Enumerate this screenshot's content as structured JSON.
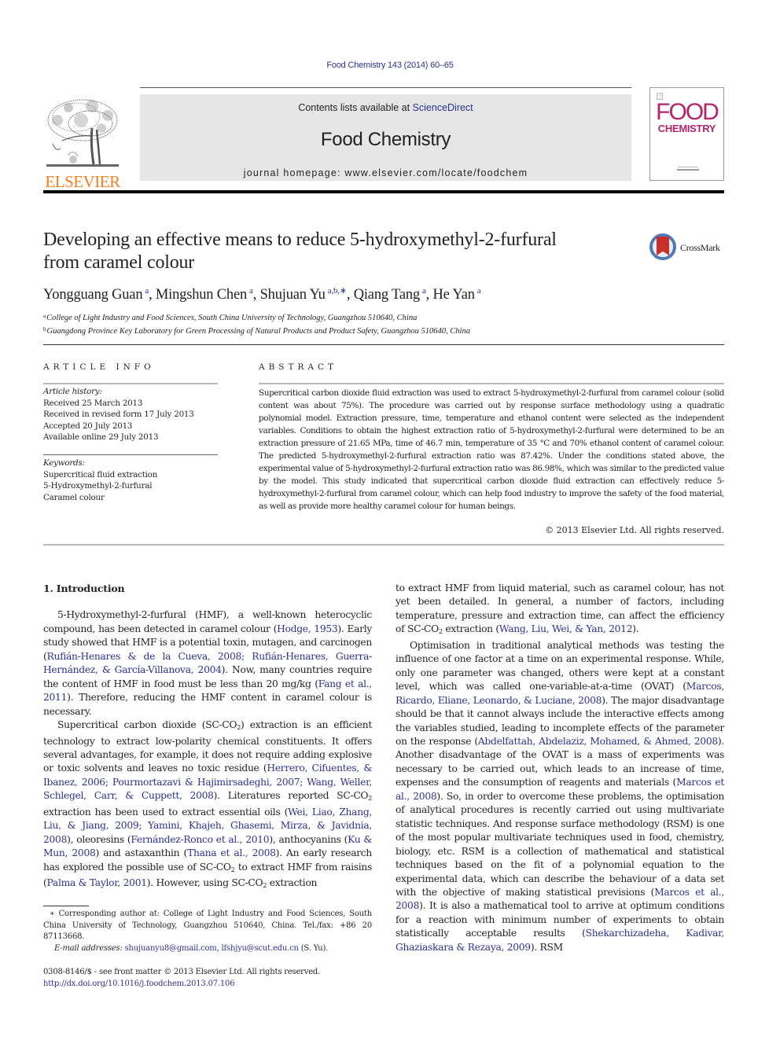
{
  "citation": "Food Chemistry 143 (2014) 60–65",
  "masthead": {
    "publisher": "ELSEVIER",
    "contents_prefix": "Contents lists available at ",
    "contents_link": "ScienceDirect",
    "journal_name": "Food Chemistry",
    "homepage": "journal homepage: www.elsevier.com/locate/foodchem",
    "cover_word1": "FOOD",
    "cover_word2": "CHEMISTRY"
  },
  "article": {
    "title_line1": "Developing an effective means to reduce 5-hydroxymethyl-2-furfural",
    "title_line2": "from caramel colour",
    "crossmark_label": "CrossMark",
    "authors": [
      {
        "name": "Yongguang Guan",
        "sup": "a"
      },
      {
        "name": "Mingshun Chen",
        "sup": "a"
      },
      {
        "name": "Shujuan Yu",
        "sup": "a,b,∗"
      },
      {
        "name": "Qiang Tang",
        "sup": "a"
      },
      {
        "name": "He Yan",
        "sup": "a"
      }
    ],
    "affiliations": [
      {
        "sup": "a",
        "text": "College of Light Industry and Food Sciences, South China University of Technology, Guangzhou 510640, China"
      },
      {
        "sup": "b",
        "text": "Guangdong Province Key Laboratory for Green Processing of Natural Products and Product Safety, Guangzhou 510640, China"
      }
    ]
  },
  "article_info": {
    "heading": "ARTICLE INFO",
    "history_label": "Article history:",
    "history": [
      "Received 25 March 2013",
      "Received in revised form 17 July 2013",
      "Accepted 20 July 2013",
      "Available online 29 July 2013"
    ],
    "keywords_label": "Keywords:",
    "keywords": [
      "Supercritical fluid extraction",
      "5-Hydroxymethyl-2-furfural",
      "Caramel colour"
    ]
  },
  "abstract": {
    "heading": "ABSTRACT",
    "text": "Supercritical carbon dioxide fluid extraction was used to extract 5-hydroxymethyl-2-furfural from caramel colour (solid content was about 75%). The procedure was carried out by response surface methodology using a quadratic polynomial model. Extraction pressure, time, temperature and ethanol content were selected as the independent variables. Conditions to obtain the highest extraction ratio of 5-hydroxymethyl-2-furfural were determined to be an extraction pressure of 21.65 MPa, time of 46.7 min, temperature of 35 °C and 70% ethanol content of caramel colour. The predicted 5-hydroxymethyl-2-furfural extraction ratio was 87.42%. Under the conditions stated above, the experimental value of 5-hydroxymethyl-2-furfural extraction ratio was 86.98%, which was similar to the predicted value by the model. This study indicated that supercritical carbon dioxide fluid extraction can effectively reduce 5-hydroxymethyl-2-furfural from caramel colour, which can help food industry to improve the safety of the food material, as well as provide more healthy caramel colour for human beings.",
    "copyright": "© 2013 Elsevier Ltd. All rights reserved."
  },
  "intro": {
    "heading": "1. Introduction",
    "p1": [
      {
        "t": "5-Hydroxymethyl-2-furfural (HMF), a well-known heterocyclic compound, has been detected in caramel colour ("
      },
      {
        "ref": "Hodge, 1953"
      },
      {
        "t": "). Early study showed that HMF is a potential toxin, mutagen, and carcinogen ("
      },
      {
        "ref": "Rufián-Henares & de la Cueva, 2008; Rufián-Henares, Guerra-Hernández, & García-Villanova, 2004"
      },
      {
        "t": "). Now, many countries require the content of HMF in food must be less than 20 mg/kg ("
      },
      {
        "ref": "Fang et al., 2011"
      },
      {
        "t": "). Therefore, reducing the HMF content in caramel colour is necessary."
      }
    ],
    "p2": [
      {
        "t": "Supercritical carbon dioxide (SC-CO"
      },
      {
        "sub": "2"
      },
      {
        "t": ") extraction is an efficient technology to extract low-polarity chemical constituents. It offers several advantages, for example, it does not require adding explosive or toxic solvents and leaves no toxic residue ("
      },
      {
        "ref": "Herrero, Cifuentes, & Ibanez, 2006; Pourmortazavi & Hajimirsadeghi, 2007; Wang, Weller, Schlegel, Carr, & Cuppett, 2008"
      },
      {
        "t": "). Literatures reported SC-CO"
      },
      {
        "sub": "2"
      },
      {
        "t": " extraction has been used to extract essential oils ("
      },
      {
        "ref": "Wei, Liao, Zhang, Liu, & Jiang, 2009; Yamini, Khajeh, Ghasemi, Mirza, & Javidnia, 2008"
      },
      {
        "t": "), oleoresins ("
      },
      {
        "ref": "Fernández-Ronco et al., 2010"
      },
      {
        "t": "), anthocyanins ("
      },
      {
        "ref": "Ku & Mun, 2008"
      },
      {
        "t": ") and astaxanthin ("
      },
      {
        "ref": "Thana et al., 2008"
      },
      {
        "t": "). An early research has explored the possible use of SC-CO"
      },
      {
        "sub": "2"
      },
      {
        "t": " to extract HMF from raisins ("
      },
      {
        "ref": "Palma & Taylor, 2001"
      },
      {
        "t": "). However, using SC-CO"
      },
      {
        "sub": "2"
      },
      {
        "t": " extraction to extract HMF from liquid material, such as caramel colour, has not yet been detailed. In general, a number of factors, including temperature, pressure and extraction time, can affect the efficiency of SC-CO"
      },
      {
        "sub": "2"
      },
      {
        "t": " extraction ("
      },
      {
        "ref": "Wang, Liu, Wei, & Yan, 2012"
      },
      {
        "t": ")."
      }
    ],
    "p3": [
      {
        "t": "Optimisation in traditional analytical methods was testing the influence of one factor at a time on an experimental response. While, only one parameter was changed, others were kept at a constant level, which was called one-variable-at-a-time (OVAT) ("
      },
      {
        "ref": "Marcos, Ricardo, Eliane, Leonardo, & Luciane, 2008"
      },
      {
        "t": "). The major disadvantage should be that it cannot always include the interactive effects among the variables studied, leading to incomplete effects of the parameter on the response ("
      },
      {
        "ref": "Abdelfattah, Abdelaziz, Mohamed, & Ahmed, 2008"
      },
      {
        "t": "). Another disadvantage of the OVAT is a mass of experiments was necessary to be carried out, which leads to an increase of time, expenses and the consumption of reagents and materials ("
      },
      {
        "ref": "Marcos et al., 2008"
      },
      {
        "t": "). So, in order to overcome these problems, the optimisation of analytical procedures is recently carried out using multivariate statistic techniques. And response surface methodology (RSM) is one of the most popular multivariate techniques used in food, chemistry, biology, etc. RSM is a collection of mathematical and statistical techniques based on the fit of a polynomial equation to the experimental data, which can describe the behaviour of a data set with the objective of making statistical previsions ("
      },
      {
        "ref": "Marcos et al., 2008"
      },
      {
        "t": "). It is also a mathematical tool to arrive at optimum conditions for a reaction with minimum number of experiments to obtain statistically acceptable results ("
      },
      {
        "ref": "Shekarchizadeha, Kadivar, Ghaziaskara & Rezaya, 2009"
      },
      {
        "t": "). RSM"
      }
    ]
  },
  "footnotes": {
    "corresponding": "∗ Corresponding author at: College of Light Industry and Food Sciences, South China University of Technology, Guangzhou 510640, China. Tel./fax: +86 20 87113668.",
    "email_label": "E-mail addresses:",
    "email1": "shujuanyu8@gmail.com",
    "email2": "lfshjyu@scut.edu.cn",
    "email_suffix": " (S. Yu).",
    "front_matter": "0308-8146/$ - see front matter © 2013 Elsevier Ltd. All rights reserved.",
    "doi": "http://dx.doi.org/10.1016/j.foodchem.2013.07.106"
  },
  "colors": {
    "link": "#2e3192",
    "elsevier_orange": "#f57f20",
    "cover_magenta": "#b3246b",
    "masthead_gray": "#e6e6e6",
    "crossmark_blue": "#4f7ab5",
    "crossmark_red": "#c9302c"
  }
}
